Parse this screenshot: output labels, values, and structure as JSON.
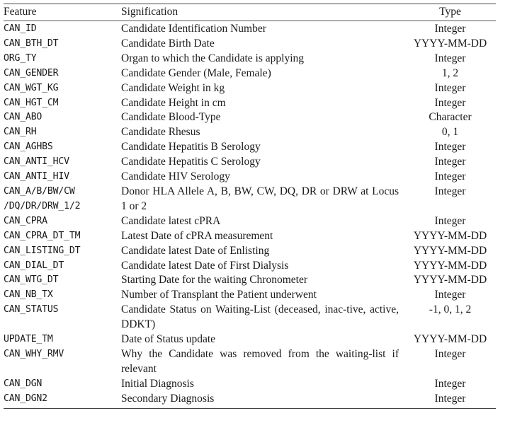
{
  "table": {
    "headers": {
      "feature": "Feature",
      "signification": "Signification",
      "type": "Type"
    },
    "rows": [
      {
        "feature": "CAN_ID",
        "signification": "Candidate Identification Number",
        "type": "Integer"
      },
      {
        "feature": "CAN_BTH_DT",
        "signification": "Candidate Birth Date",
        "type": "YYYY-MM-DD"
      },
      {
        "feature": "ORG_TY",
        "signification": "Organ to which the Candidate is applying",
        "type": "Integer"
      },
      {
        "feature": "CAN_GENDER",
        "signification": "Candidate Gender (Male, Female)",
        "type": "1, 2"
      },
      {
        "feature": "CAN_WGT_KG",
        "signification": "Candidate Weight in kg",
        "type": "Integer"
      },
      {
        "feature": "CAN_HGT_CM",
        "signification": "Candidate Height in cm",
        "type": "Integer"
      },
      {
        "feature": "CAN_ABO",
        "signification": "Candidate Blood-Type",
        "type": "Character"
      },
      {
        "feature": "CAN_RH",
        "signification": "Candidate Rhesus",
        "type": "0, 1"
      },
      {
        "feature": "CAN_AGHBS",
        "signification": "Candidate Hepatitis B Serology",
        "type": "Integer"
      },
      {
        "feature": "CAN_ANTI_HCV",
        "signification": "Candidate Hepatitis C Serology",
        "type": "Integer"
      },
      {
        "feature": "CAN_ANTI_HIV",
        "signification": "Candidate HIV Serology",
        "type": "Integer"
      },
      {
        "feature": "CAN_A/B/BW/CW\n/DQ/DR/DRW_1/2",
        "signification": "Donor HLA Allele A, B, BW, CW, DQ, DR or DRW at Locus 1 or 2",
        "type": "Integer"
      },
      {
        "feature": "CAN_CPRA",
        "signification": "Candidate latest cPRA",
        "type": "Integer"
      },
      {
        "feature": "CAN_CPRA_DT_TM",
        "signification": "Latest Date of cPRA measurement",
        "type": "YYYY-MM-DD"
      },
      {
        "feature": "CAN_LISTING_DT",
        "signification": "Candidate latest Date of Enlisting",
        "type": "YYYY-MM-DD"
      },
      {
        "feature": "CAN_DIAL_DT",
        "signification": "Candidate latest Date of First Dialysis",
        "type": "YYYY-MM-DD"
      },
      {
        "feature": "CAN_WTG_DT",
        "signification": "Starting Date for the waiting Chronometer",
        "type": "YYYY-MM-DD"
      },
      {
        "feature": "CAN_NB_TX",
        "signification": "Number of Transplant the Patient underwent",
        "type": "Integer"
      },
      {
        "feature": "CAN_STATUS",
        "signification": "Candidate Status on Waiting-List (deceased, inac-­tive, active, DDKT)",
        "type": "-1, 0, 1, 2"
      },
      {
        "feature": "UPDATE_TM",
        "signification": "Date of Status update",
        "type": "YYYY-MM-DD"
      },
      {
        "feature": "CAN_WHY_RMV",
        "signification": "Why the Candidate was removed from the waiting-list if relevant",
        "type": "Integer"
      },
      {
        "feature": "CAN_DGN",
        "signification": "Initial Diagnosis",
        "type": "Integer"
      },
      {
        "feature": "CAN_DGN2",
        "signification": "Secondary Diagnosis",
        "type": "Integer"
      }
    ]
  }
}
